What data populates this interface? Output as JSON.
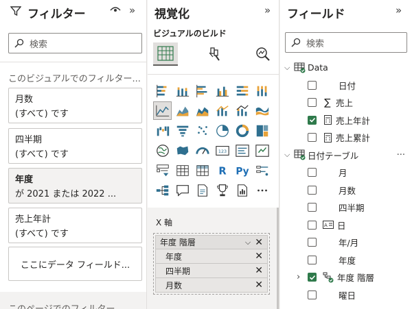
{
  "filters": {
    "title": "フィルター",
    "search_placeholder": "検索",
    "visual_section": "このビジュアルでのフィルター...",
    "cards": [
      {
        "title": "月数",
        "value": "(すべて) です",
        "selected": false
      },
      {
        "title": "四半期",
        "value": "(すべて) です",
        "selected": false
      },
      {
        "title": "年度",
        "value": "が 2021 または 2022 ...",
        "selected": true
      },
      {
        "title": "売上年計",
        "value": "(すべて) です",
        "selected": false
      }
    ],
    "drop_hint": "ここにデータ フィールド...",
    "page_section": "このページでのフィルター"
  },
  "viz": {
    "title": "視覚化",
    "subtitle": "ビジュアルのビルド",
    "tabs": [
      "build-visual",
      "format-visual",
      "analytics"
    ],
    "gallery_icons": [
      "stacked-bar-icon",
      "stacked-column-icon",
      "clustered-bar-icon",
      "clustered-column-icon",
      "100-stacked-bar-icon",
      "100-stacked-column-icon",
      "line-chart-icon",
      "area-chart-icon",
      "stacked-area-icon",
      "line-clustered-column-icon",
      "line-stacked-column-icon",
      "ribbon-chart-icon",
      "waterfall-icon",
      "funnel-icon",
      "scatter-icon",
      "pie-chart-icon",
      "donut-chart-icon",
      "treemap-icon",
      "map-icon",
      "filled-map-icon",
      "gauge-icon",
      "card-icon",
      "multi-row-card-icon",
      "kpi-icon",
      "slicer-icon",
      "table-icon",
      "matrix-icon",
      "r-visual-icon",
      "python-visual-icon",
      "key-influencers-icon",
      "decomposition-tree-icon",
      "qa-icon",
      "smart-narrative-icon",
      "metrics-icon",
      "paginated-report-icon",
      "more-icon"
    ],
    "xaxis_label": "X 軸",
    "well": {
      "hierarchy": "年度 階層",
      "levels": [
        "年度",
        "四半期",
        "月数"
      ]
    }
  },
  "fields": {
    "title": "フィールド",
    "search_placeholder": "検索",
    "tables": [
      {
        "name": "Data",
        "items": [
          {
            "name": "日付",
            "checked": false,
            "icon": ""
          },
          {
            "name": "売上",
            "checked": false,
            "icon": "sigma-icon"
          },
          {
            "name": "売上年計",
            "checked": true,
            "icon": "calculator-icon"
          },
          {
            "name": "売上累計",
            "checked": false,
            "icon": "calculator-icon"
          }
        ]
      },
      {
        "name": "日付テーブル",
        "items": [
          {
            "name": "月",
            "checked": false,
            "icon": ""
          },
          {
            "name": "月数",
            "checked": false,
            "icon": ""
          },
          {
            "name": "四半期",
            "checked": false,
            "icon": ""
          },
          {
            "name": "日",
            "checked": false,
            "icon": "text-field-icon"
          },
          {
            "name": "年/月",
            "checked": false,
            "icon": ""
          },
          {
            "name": "年度",
            "checked": false,
            "icon": ""
          },
          {
            "name": "年度 階層",
            "checked": true,
            "icon": "hierarchy-icon"
          },
          {
            "name": "曜日",
            "checked": false,
            "icon": ""
          }
        ]
      }
    ],
    "more": "···"
  },
  "colors": {
    "accent_green": "#2f7a4b",
    "border": "#c8c6c4",
    "pane_bg": "#f3f2f1"
  }
}
